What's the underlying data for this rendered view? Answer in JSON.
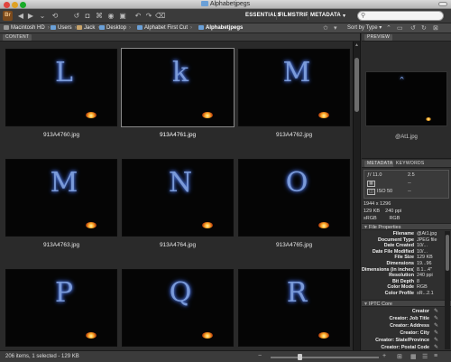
{
  "window": {
    "title": "Alphabetjpegs"
  },
  "toolbar": {
    "app_logo": "Br",
    "workspaces": [
      "ESSENTIALS",
      "FILMSTRIP",
      "METADATA"
    ],
    "workspace_dropdown": "▾",
    "search_placeholder": ""
  },
  "path": {
    "crumbs": [
      "Macintosh HD",
      "Users",
      "Jack",
      "Desktop",
      "Alphabet First Cut",
      "Alphabetjpegs"
    ],
    "sort_label": "Sort by Type"
  },
  "content": {
    "tab_label": "CONTENT",
    "thumbnails": [
      {
        "filename": "913A4760.jpg",
        "letter": "L",
        "selected": false
      },
      {
        "filename": "913A4761.jpg",
        "letter": "k",
        "selected": true
      },
      {
        "filename": "913A4762.jpg",
        "letter": "M",
        "selected": false
      },
      {
        "filename": "913A4763.jpg",
        "letter": "M",
        "selected": false
      },
      {
        "filename": "913A4764.jpg",
        "letter": "N",
        "selected": false
      },
      {
        "filename": "913A4765.jpg",
        "letter": "O",
        "selected": false
      },
      {
        "filename": "",
        "letter": "P",
        "selected": false
      },
      {
        "filename": "",
        "letter": "Q",
        "selected": false
      },
      {
        "filename": "",
        "letter": "R",
        "selected": false
      }
    ]
  },
  "preview": {
    "tab_label": "PREVIEW",
    "caption": "@At1.jpg",
    "letter": "ˆ"
  },
  "metadata": {
    "tabs": [
      "METADATA",
      "KEYWORDS"
    ],
    "camera": {
      "fstop": "ƒ/ 11.0",
      "shutter": "2.5",
      "dash1": "--",
      "dash2": "--",
      "iso": "ISO 50",
      "dimensions": "1944 x 1296",
      "size": "129 KB",
      "ppi": "240 ppi",
      "colorspace": "sRGB",
      "mode": "RGB"
    },
    "file_properties_title": "File Properties",
    "file_properties": [
      {
        "key": "Filename",
        "value": "@At1.jpg"
      },
      {
        "key": "Document Type",
        "value": "JPEG file"
      },
      {
        "key": "Date Created",
        "value": "10/..."
      },
      {
        "key": "Date File Modified",
        "value": "10/..."
      },
      {
        "key": "File Size",
        "value": "129 KB"
      },
      {
        "key": "Dimensions",
        "value": "19...96"
      },
      {
        "key": "Dimensions (in inches)",
        "value": "8.1...4\""
      },
      {
        "key": "Resolution",
        "value": "240 ppi"
      },
      {
        "key": "Bit Depth",
        "value": "8"
      },
      {
        "key": "Color Mode",
        "value": "RGB"
      },
      {
        "key": "Color Profile",
        "value": "sR...2.1"
      }
    ],
    "iptc_title": "IPTC Core",
    "iptc": [
      {
        "key": "Creator"
      },
      {
        "key": "Creator: Job Title"
      },
      {
        "key": "Creator: Address"
      },
      {
        "key": "Creator: City"
      },
      {
        "key": "Creator: State/Province"
      },
      {
        "key": "Creator: Postal Code"
      }
    ]
  },
  "status": {
    "text": "206 items, 1 selected - 129 KB"
  },
  "colors": {
    "panel_bg": "#2a2a2a",
    "thumb_bg": "#050505",
    "glow": "#8fb4ff",
    "fire": "#ffb02a",
    "logo": "#7b4a1c"
  },
  "icons": [
    "back-icon",
    "forward-icon",
    "recent-icon",
    "camera-icon",
    "refine-icon",
    "rotate-left-icon",
    "rotate-right-icon",
    "trash-icon",
    "search-icon",
    "pencil-icon",
    "folder-icon"
  ]
}
